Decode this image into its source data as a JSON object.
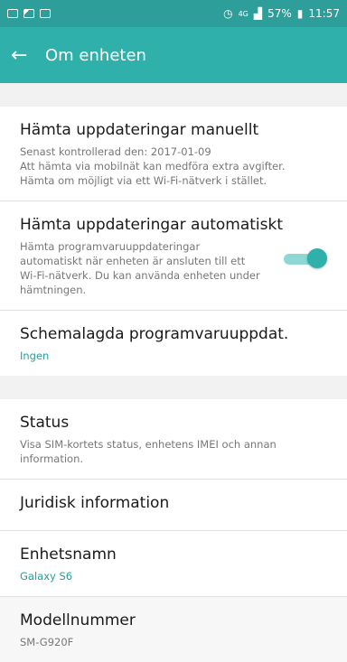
{
  "status_bar": {
    "left_icons": [
      "notification-icon",
      "image-icon",
      "screenshot-icon"
    ],
    "right": {
      "icons": [
        "alarm-icon",
        "4g-icon",
        "signal-icon"
      ],
      "battery": "57%",
      "time": "11:57"
    }
  },
  "app_bar": {
    "back_icon": "arrow-left",
    "title": "Om enheten"
  },
  "section1": {
    "manual": {
      "title": "Hämta uppdateringar manuellt",
      "lines": [
        "Senast kontrollerad den: 2017-01-09",
        "Att hämta via mobilnät kan medföra extra avgifter.",
        "Hämta om möjligt via ett Wi-Fi-nätverk i stället."
      ]
    },
    "auto": {
      "title": "Hämta uppdateringar automatiskt",
      "lines": [
        "Hämta programvaruuppdateringar",
        "automatiskt när enheten är ansluten till ett",
        "Wi-Fi-nätverk. Du kan använda enheten under",
        "hämtningen."
      ],
      "toggle_on": true
    },
    "scheduled": {
      "title": "Schemalagda programvaruuppdat.",
      "value": "Ingen"
    }
  },
  "section2": {
    "status": {
      "title": "Status",
      "lines": [
        "Visa SIM-kortets status, enhetens IMEI och annan",
        "information."
      ]
    },
    "legal": {
      "title": "Juridisk information"
    },
    "device_name": {
      "title": "Enhetsnamn",
      "value": "Galaxy S6"
    },
    "model": {
      "title": "Modellnummer",
      "value": "SM-G920F"
    }
  },
  "colors": {
    "status_bar": "#2e9e9a",
    "app_bar": "#2fb0ab",
    "accent": "#2a9d98"
  }
}
